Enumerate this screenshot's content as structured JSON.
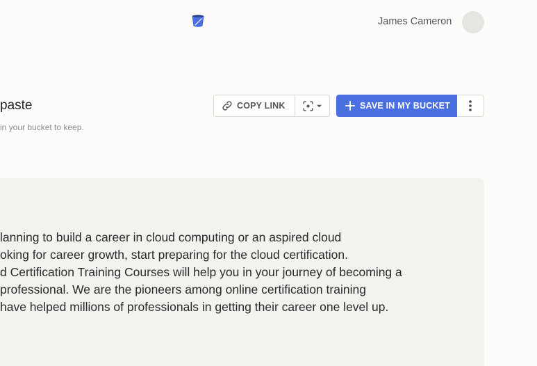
{
  "header": {
    "user_name": "James Cameron",
    "logo_icon": "bucket-icon",
    "avatar_icon": "user-avatar"
  },
  "page": {
    "title": "paste",
    "hint": "in your bucket to keep."
  },
  "toolbar": {
    "copy_link_label": "COPY LINK",
    "copy_link_icon": "link-icon",
    "capture_icon": "screenshot-icon",
    "save_label": "SAVE IN MY BUCKET",
    "save_icon": "plus-icon",
    "more_icon": "more-vertical-icon"
  },
  "content": {
    "lines": [
      "lanning to build a career in cloud computing or an aspired cloud",
      "oking for career growth, start preparing for the cloud certification.",
      "d Certification Training Courses will help you in your journey of becoming a",
      "professional. We are the pioneers among online certification training",
      "have helped millions of professionals in getting their career one level up."
    ]
  },
  "colors": {
    "accent": "#4a6fe0",
    "background": "#fdfcfa",
    "card": "#f4f2ee"
  }
}
